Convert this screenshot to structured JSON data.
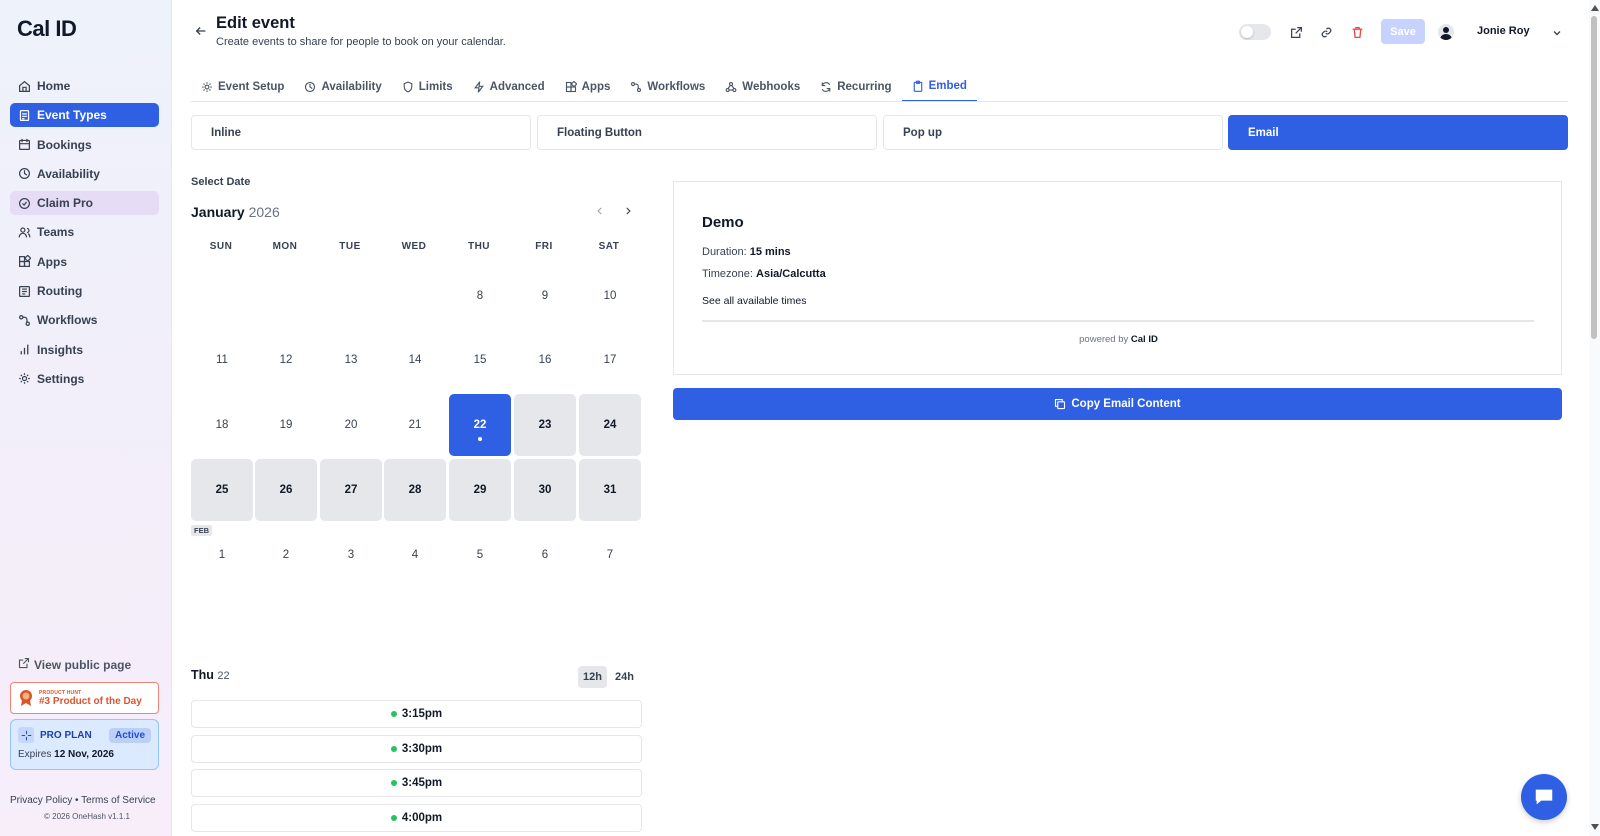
{
  "app": {
    "logo": "Cal ID"
  },
  "sidebar": {
    "items": [
      {
        "label": "Home",
        "icon": "home-icon"
      },
      {
        "label": "Event Types",
        "icon": "event-types-icon",
        "active": true
      },
      {
        "label": "Bookings",
        "icon": "calendar-icon"
      },
      {
        "label": "Availability",
        "icon": "clock-icon"
      },
      {
        "label": "Claim Pro",
        "icon": "badge-icon"
      },
      {
        "label": "Teams",
        "icon": "users-icon"
      },
      {
        "label": "Apps",
        "icon": "grid-icon"
      },
      {
        "label": "Routing",
        "icon": "routing-icon"
      },
      {
        "label": "Workflows",
        "icon": "workflow-icon"
      },
      {
        "label": "Insights",
        "icon": "bar-chart-icon"
      },
      {
        "label": "Settings",
        "icon": "gear-icon"
      }
    ],
    "public_page": "View public page",
    "product_hunt": {
      "small": "PRODUCT HUNT",
      "big": "#3 Product of the Day"
    },
    "plan": {
      "title": "PRO PLAN",
      "status": "Active",
      "expires_label": "Expires",
      "expires_date": "12 Nov, 2026"
    },
    "footer": {
      "privacy": "Privacy Policy",
      "sep": "•",
      "terms": "Terms of Service",
      "copyright": "© 2026 OneHash v1.1.1"
    }
  },
  "header": {
    "title": "Edit event",
    "subtitle": "Create events to share for people to book on your calendar.",
    "save_label": "Save",
    "user_name": "Jonie Roy"
  },
  "tabs": [
    {
      "label": "Event Setup"
    },
    {
      "label": "Availability"
    },
    {
      "label": "Limits"
    },
    {
      "label": "Advanced"
    },
    {
      "label": "Apps"
    },
    {
      "label": "Workflows"
    },
    {
      "label": "Webhooks"
    },
    {
      "label": "Recurring"
    },
    {
      "label": "Embed",
      "active": true
    }
  ],
  "embed_types": [
    {
      "label": "Inline"
    },
    {
      "label": "Floating Button"
    },
    {
      "label": "Pop up"
    },
    {
      "label": "Email",
      "active": true
    }
  ],
  "calendar": {
    "select_label": "Select Date",
    "month": "January",
    "year": "2026",
    "weekdays": [
      "SUN",
      "MON",
      "TUE",
      "WED",
      "THU",
      "FRI",
      "SAT"
    ],
    "rows": [
      [
        "",
        "",
        "",
        "",
        "8",
        "9",
        "10"
      ],
      [
        "11",
        "12",
        "13",
        "14",
        "15",
        "16",
        "17"
      ],
      [
        "18",
        "19",
        "20",
        "21",
        "22",
        "23",
        "24"
      ],
      [
        "25",
        "26",
        "27",
        "28",
        "29",
        "30",
        "31"
      ],
      [
        "1",
        "2",
        "3",
        "4",
        "5",
        "6",
        "7"
      ]
    ],
    "selected": "22",
    "available": [
      "22",
      "23",
      "24",
      "25",
      "26",
      "27",
      "28",
      "29",
      "30",
      "31"
    ],
    "next_month_tag": "FEB"
  },
  "slots": {
    "day_label": "Thu",
    "day_num": "22",
    "fmt_12": "12h",
    "fmt_24": "24h",
    "times": [
      "3:15pm",
      "3:30pm",
      "3:45pm",
      "4:00pm"
    ]
  },
  "preview": {
    "title": "Demo",
    "duration_label": "Duration:",
    "duration_value": "15 mins",
    "timezone_label": "Timezone:",
    "timezone_value": "Asia/Calcutta",
    "see_all": "See all available times",
    "powered_by": "powered by",
    "powered_brand": "Cal ID"
  },
  "copy_button": "Copy Email Content",
  "colors": {
    "accent": "#2f5fe3",
    "available_day": "#e5e7eb",
    "slot_dot": "#22c55e",
    "delete": "#ef4444"
  }
}
